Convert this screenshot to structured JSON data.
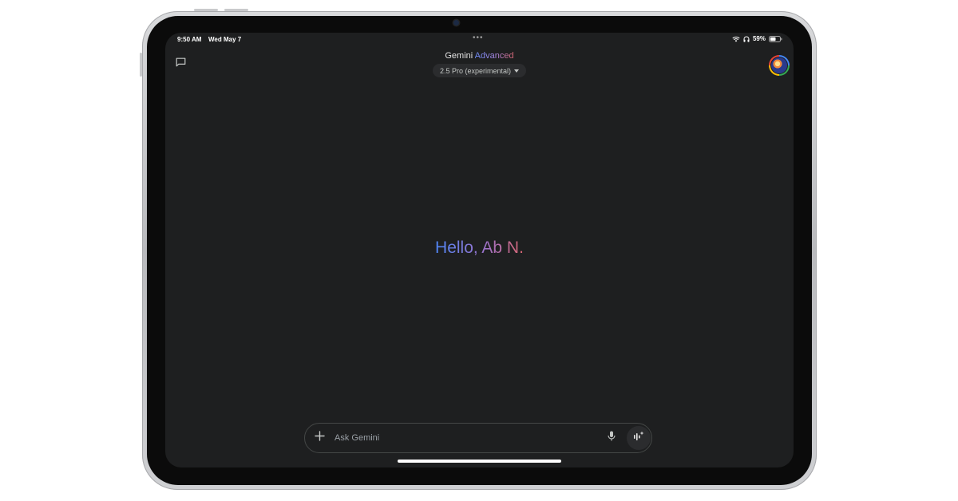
{
  "status_bar": {
    "time": "9:50 AM",
    "date": "Wed May 7",
    "multitask_dots": "•••",
    "battery_percent": "59%",
    "battery_level": 0.59,
    "icons": [
      "wifi-icon",
      "headphones-icon",
      "battery-icon"
    ]
  },
  "header": {
    "title_part1": "Gemini",
    "title_part2": "Advanced",
    "model_label": "2.5 Pro (experimental)"
  },
  "sidebar_toggle": {
    "icon": "new-chat-icon"
  },
  "profile": {
    "icon": "avatar"
  },
  "main": {
    "greeting": "Hello, Ab N."
  },
  "composer": {
    "placeholder": "Ask Gemini",
    "value": "",
    "add_icon": "plus-icon",
    "mic_icon": "mic-icon",
    "live_icon": "gemini-live-icon"
  },
  "colors": {
    "screen_bg": "#1e1f20",
    "text_primary": "#e3e3e3",
    "gradient_blue": "#4f86f7",
    "gradient_purple": "#9b72cb",
    "gradient_red": "#d96570"
  }
}
